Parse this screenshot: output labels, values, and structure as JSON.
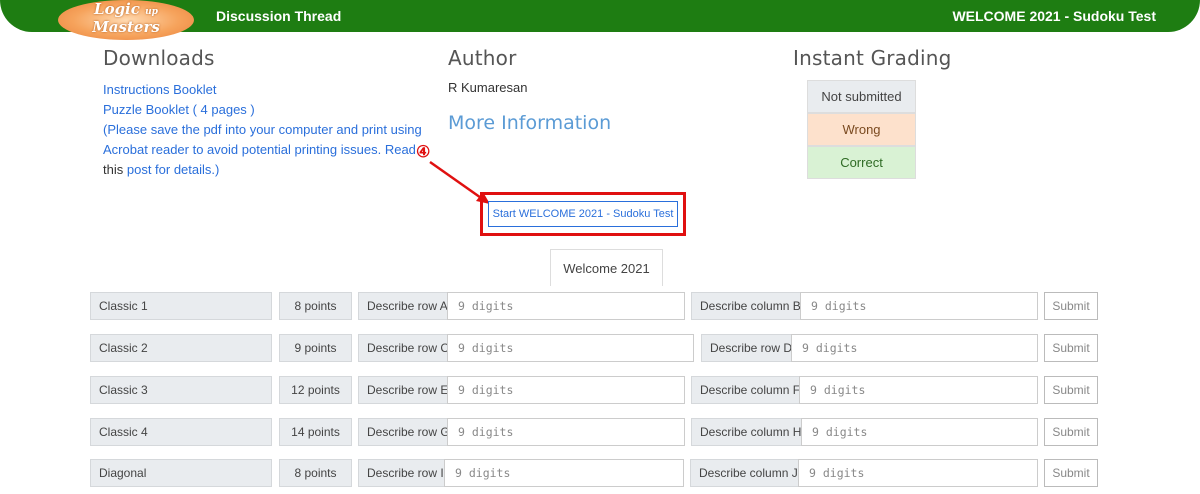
{
  "header": {
    "logo_line1": "Logic",
    "logo_small": "up",
    "logo_line2": "Masters",
    "nav_label": "Discussion Thread",
    "title": "WELCOME 2021 - Sudoku Test"
  },
  "downloads": {
    "heading": "Downloads",
    "instructions_link": "Instructions Booklet",
    "puzzle_link": "Puzzle Booklet ( 4 pages )",
    "note_line1": "(Please save the pdf into your computer and print using",
    "note_line2": "Acrobat reader to avoid potential printing issues. Read",
    "note_this": "this",
    "note_link": "post for details.)"
  },
  "author": {
    "heading": "Author",
    "name": "R Kumaresan",
    "more_info": "More Information"
  },
  "grading": {
    "heading": "Instant Grading",
    "not_submitted": "Not submitted",
    "wrong": "Wrong",
    "correct": "Correct"
  },
  "annotation": {
    "marker": "④",
    "color": "#e01010"
  },
  "start_button": "Start WELCOME 2021 - Sudoku Test",
  "tab": "Welcome 2021",
  "rows": [
    {
      "name": "Classic 1",
      "points": "8 points",
      "row_label": "Describe row A",
      "row_placeholder": "9 digits",
      "col_label": "Describe column B",
      "col_placeholder": "9 digits",
      "submit": "Submit"
    },
    {
      "name": "Classic 2",
      "points": "9 points",
      "row_label": "Describe row C",
      "row_placeholder": "9 digits",
      "col_label": "Describe row D",
      "col_placeholder": "9 digits",
      "submit": "Submit"
    },
    {
      "name": "Classic 3",
      "points": "12 points",
      "row_label": "Describe row E",
      "row_placeholder": "9 digits",
      "col_label": "Describe column F",
      "col_placeholder": "9 digits",
      "submit": "Submit"
    },
    {
      "name": "Classic 4",
      "points": "14 points",
      "row_label": "Describe row G",
      "row_placeholder": "9 digits",
      "col_label": "Describe column H",
      "col_placeholder": "9 digits",
      "submit": "Submit"
    },
    {
      "name": "Diagonal",
      "points": "8 points",
      "row_label": "Describe row I",
      "row_placeholder": "9 digits",
      "col_label": "Describe column J",
      "col_placeholder": "9 digits",
      "submit": "Submit"
    }
  ],
  "colors": {
    "header_green": "#1e7d12",
    "link_blue": "#2a6fdb",
    "wrong_bg": "#fde1cc",
    "correct_bg": "#d9f2d4"
  }
}
